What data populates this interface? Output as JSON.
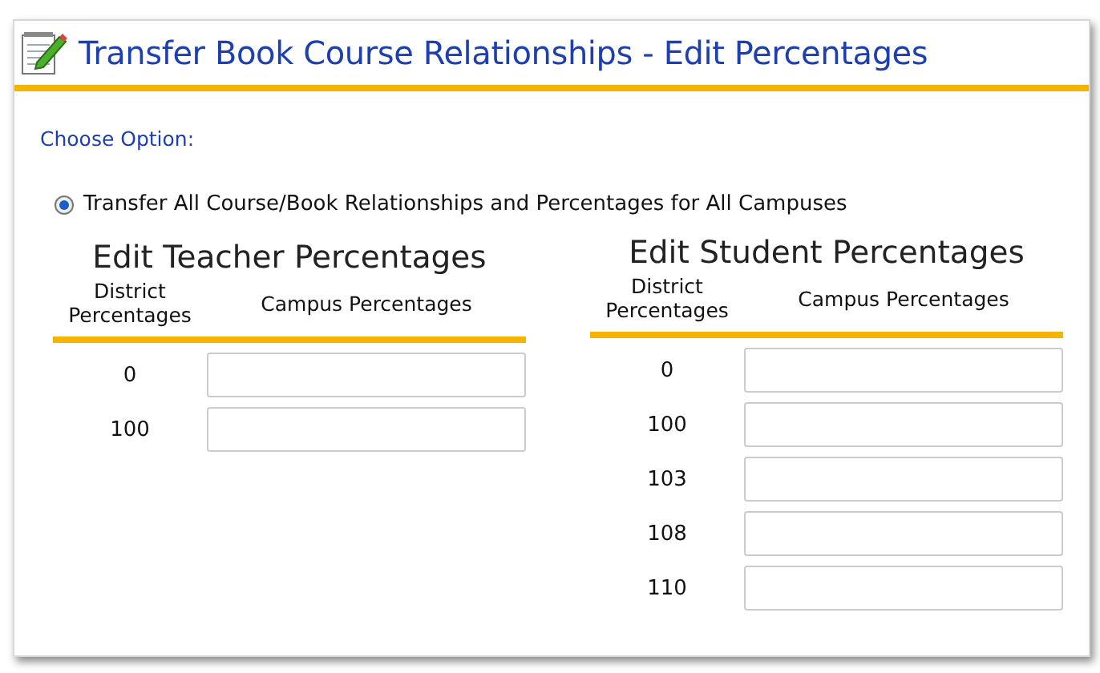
{
  "window": {
    "title": "Transfer Book Course Relationships - Edit Percentages"
  },
  "choose_option": {
    "label": "Choose Option:",
    "options": [
      {
        "label": "Transfer All Course/Book Relationships and Percentages for All Campuses",
        "selected": true
      }
    ]
  },
  "sections": [
    {
      "title": "Edit Teacher Percentages",
      "columns": [
        "District Percentages",
        "Campus Percentages"
      ],
      "rows": [
        {
          "district": "0"
        },
        {
          "district": "100"
        }
      ]
    },
    {
      "title": "Edit Student Percentages",
      "columns": [
        "District Percentages",
        "Campus Percentages"
      ],
      "rows": [
        {
          "district": "0"
        },
        {
          "district": "100"
        },
        {
          "district": "103"
        },
        {
          "district": "108"
        },
        {
          "district": "110"
        }
      ]
    }
  ]
}
